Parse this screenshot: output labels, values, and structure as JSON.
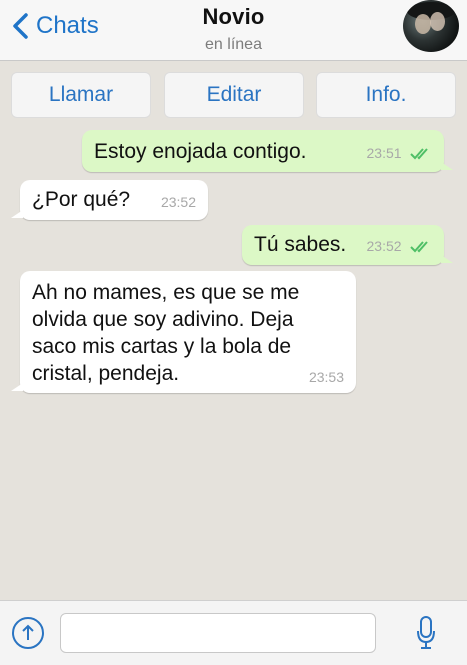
{
  "header": {
    "back_label": "Chats",
    "title": "Novio",
    "subtitle": "en línea"
  },
  "actions": {
    "call_label": "Llamar",
    "edit_label": "Editar",
    "info_label": "Info."
  },
  "messages": [
    {
      "direction": "out",
      "text": "Estoy enojada contigo.",
      "time": "23:51",
      "status": "read"
    },
    {
      "direction": "in",
      "text": "¿Por qué?",
      "time": "23:52"
    },
    {
      "direction": "out",
      "text": "Tú sabes.",
      "time": "23:52",
      "status": "read"
    },
    {
      "direction": "in",
      "text_lines": [
        "Ah no mames, es que se me",
        "olvida que soy adivino. Deja",
        "saco mis cartas y la bola de",
        "cristal, pendeja."
      ],
      "time": "23:53"
    }
  ],
  "input": {
    "placeholder": "",
    "value": ""
  },
  "icons": {
    "back": "chevron-left-icon",
    "attach": "upload-arrow-icon",
    "mic": "microphone-icon",
    "read_receipt": "double-check-icon"
  },
  "colors": {
    "accent": "#1f74c8",
    "outgoing_bubble": "#dcf8c6",
    "incoming_bubble": "#ffffff",
    "chat_background": "#e5e2dc",
    "read_check": "#4fbf66"
  }
}
